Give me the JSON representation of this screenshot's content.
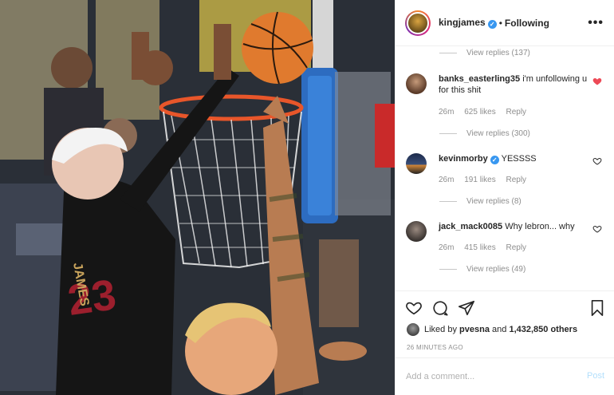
{
  "header": {
    "username": "kingjames",
    "separator": "•",
    "follow_status": "Following",
    "more": "•••"
  },
  "comments": {
    "top_replies": "View replies (137)",
    "items": [
      {
        "username": "banks_easterling35",
        "text": "i'm unfollowing u for this shit",
        "time": "26m",
        "likes": "625 likes",
        "reply": "Reply",
        "view_replies": "View replies (300)",
        "liked": true,
        "verified": false
      },
      {
        "username": "kevinmorby",
        "text": "YESSSS",
        "time": "26m",
        "likes": "191 likes",
        "reply": "Reply",
        "view_replies": "View replies (8)",
        "liked": false,
        "verified": true
      },
      {
        "username": "jack_mack0085",
        "text": "Why lebron... why",
        "time": "26m",
        "likes": "415 likes",
        "reply": "Reply",
        "view_replies": "View replies (49)",
        "liked": false,
        "verified": false
      }
    ]
  },
  "actions": {
    "liked_by_prefix": "Liked by",
    "liked_by_user": "pvesna",
    "liked_by_and": "and",
    "liked_by_count": "1,432,850 others",
    "time_ago": "26 MINUTES AGO"
  },
  "add_comment": {
    "placeholder": "Add a comment...",
    "post_label": "Post"
  },
  "colors": {
    "accent": "#3897f0",
    "heart": "#ed4956",
    "post_disabled": "#b2dffc",
    "muted": "#8e8e8e"
  },
  "icons": [
    "heart-icon",
    "comment-icon",
    "share-icon",
    "bookmark-icon",
    "more-options-icon",
    "verified-badge-icon"
  ]
}
